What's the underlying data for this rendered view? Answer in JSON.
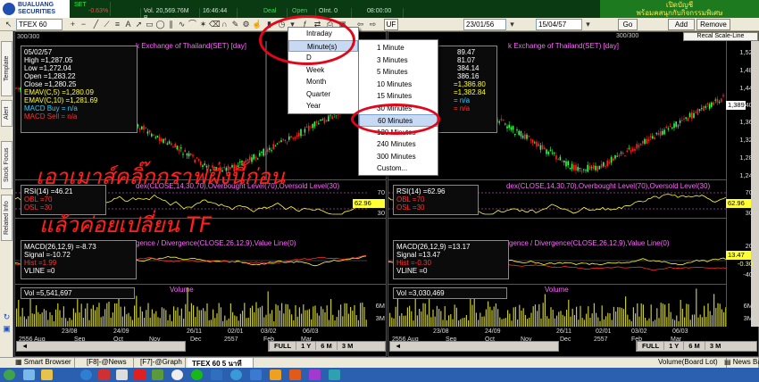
{
  "topbar": {
    "broker_line1": "BUALUANG",
    "broker_line2": "SECURITIES",
    "tickers": [
      {
        "label": "SET",
        "value": "",
        "change": ""
      },
      {
        "label": "%Chg",
        "value": "-0.63%",
        "change": "neg"
      },
      {
        "label": "Vol",
        "value": "Vol. 20,569.76M B.",
        "change": ""
      },
      {
        "label": "Time",
        "value": "16:46:44",
        "change": ""
      },
      {
        "label": "Deal",
        "value": "Deal",
        "change": ""
      },
      {
        "label": "Open",
        "value": "Open",
        "change": "pos"
      },
      {
        "label": "OInt",
        "value": "OInt. 0",
        "change": ""
      },
      {
        "label": "Clock",
        "value": "08:00:00",
        "change": ""
      }
    ],
    "ad_line1": "เปิดบัญชี",
    "ad_line2": "พร้อมคสนุกกับกิจกรรมพิเศษ"
  },
  "toolbar": {
    "symbol": "TFEX 60",
    "interval_button": "UF",
    "date_from": "23/01/56",
    "date_to": "15/04/57",
    "go": "Go",
    "add": "Add",
    "remove": "Remove",
    "linear_label": "-Linear",
    "counter_left": "300/300",
    "counter_right": "300/300",
    "recalc": "Recal Scale-Line"
  },
  "left_tabs": [
    "Template",
    "Alert",
    "Stock Focus",
    "Related Info"
  ],
  "period_menu": {
    "items": [
      "Intraday",
      "Minute(s)",
      "D",
      "Week",
      "Month",
      "Quarter",
      "Year"
    ],
    "selected": "Minute(s)"
  },
  "minute_submenu": {
    "items": [
      "1 Minute",
      "3 Minutes",
      "5 Minutes",
      "10 Minutes",
      "15 Minutes",
      "30 Minutes",
      "60 Minutes",
      "120 Minutes",
      "240 Minutes",
      "300 Minutes",
      "Custom..."
    ],
    "selected": "60 Minutes"
  },
  "left_chart": {
    "title": "k Exchange of Thailand(SET) [day]",
    "info": {
      "date": "05/02/57",
      "high": "High   =1,287.05",
      "low": "Low    =1,272.04",
      "open": "Open   =1,283.22",
      "close": "Close  =1,280.25",
      "ema5": "EMAV(C,5)   =1,280.09",
      "ema10": "EMAV(C,10)  =1,281.69",
      "macd_buy": "MACD Buy  = n/a",
      "macd_sell": "MACD Sell = n/a"
    },
    "rsi_head": "dex(CLOSE,14,30,70),Overbought Level(70),Oversold Level(30)",
    "rsi_info": {
      "rsi": "RSI(14)  =46.21",
      "obl": "OBL   =70",
      "osl": "OSL   =30"
    },
    "macd_head": "gence / Divergence(CLOSE,26,12,9),Value Line(0)",
    "macd_info": {
      "macd": "MACD(26,12,9)   =-8.73",
      "signal": "Signal  =-10.72",
      "hist": "Hist   =1.99",
      "vline": "VLINE   =0"
    },
    "vol_title": "Volume",
    "vol_info": "Vol   =5,541,697",
    "x_dates": [
      "23/08",
      "24/09",
      "26/11",
      "02/01",
      "03/02",
      "06/03"
    ],
    "x_months": [
      "2556 Aug",
      "Sep",
      "Oct",
      "Nov",
      "Dec",
      "2557",
      "Feb",
      "Mar"
    ],
    "range_buttons": [
      "FULL",
      "1 Y",
      "6 M",
      "3 M"
    ]
  },
  "right_chart": {
    "title": "k Exchange of Thailand(SET) [day]",
    "info": {
      "v1": "89.47",
      "v2": "81.07",
      "v3": "384.14",
      "v4": "386.16",
      "ema5": "=1,386.80",
      "ema10": "=1,382.84",
      "macd_buy": "= n/a",
      "macd_sell": "= n/a"
    },
    "rsi_head": "dex(CLOSE,14,30,70),Overbought Level(70),Oversold Level(30)",
    "rsi_info": {
      "rsi": "RSI(14)  =62.96",
      "obl": "OBL   =70",
      "osl": "OSL   =30"
    },
    "macd_head": "gence / Divergence(CLOSE,26,12,9),Value Line(0)",
    "macd_info": {
      "macd": "MACD(26,12,9)   =13.17",
      "signal": "Signal  =13.47",
      "hist": "Hist   =-0.30",
      "vline": "VLINE   =0"
    },
    "vol_title": "Volume",
    "vol_info": "Vol   =3,030,469",
    "x_dates": [
      "23/08",
      "24/09",
      "26/11",
      "02/01",
      "03/02",
      "06/03"
    ],
    "x_months": [
      "2556 Aug",
      "Sep",
      "Oct",
      "Nov",
      "Dec",
      "2557",
      "Feb",
      "Mar"
    ],
    "range_buttons": [
      "FULL",
      "1 Y",
      "6 M",
      "3 M"
    ]
  },
  "axes": {
    "price_ticks": [
      "1,520",
      "1,480",
      "1,440",
      "1,400",
      "1,360",
      "1,320",
      "1,280",
      "1,240",
      "1,200"
    ],
    "price_tag_right": "1,389",
    "rsi_ticks": [
      "70",
      "30"
    ],
    "rsi_tag_left": "62.96",
    "rsi_tag_right": "62.96",
    "macd_ticks": [
      "20",
      "0",
      "-20",
      "-40"
    ],
    "macd_tag_a": "13.47",
    "macd_tag_b": "-0.30",
    "vol_ticks": [
      "6M",
      "3M"
    ]
  },
  "overlay_text": {
    "line1": "เอาเมาส์คลิ๊กกราฟฝั่งนี้ก่อน",
    "line2": "แล้วค่อยเปลี่ยน TF"
  },
  "bottom_tabs": [
    "Smart Browser",
    "[F8]-@News",
    "[F7]-@Graph",
    "TFEX 60 5 นาที"
  ],
  "bottom_right": [
    "Volume(Board Lot)",
    "News Bar"
  ],
  "colors": {
    "accent_red": "#e3061a",
    "price_up": "#2eff4a",
    "price_down": "#ff2020",
    "volume": "#c8c832"
  }
}
